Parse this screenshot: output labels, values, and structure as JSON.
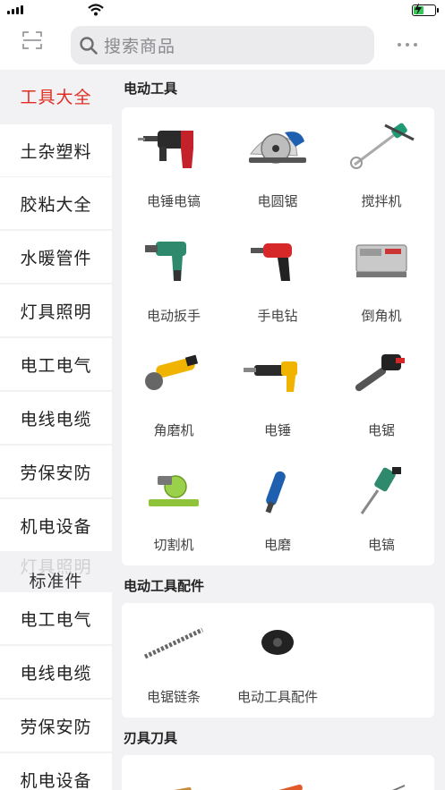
{
  "header": {
    "search_placeholder": "搜索商品"
  },
  "sidebar": {
    "items": [
      {
        "label": "工具大全",
        "active": true
      },
      {
        "label": "土杂塑料",
        "active": false
      },
      {
        "label": "胶粘大全",
        "active": false
      },
      {
        "label": "水暖管件",
        "active": false
      },
      {
        "label": "灯具照明",
        "active": false
      },
      {
        "label": "电工电气",
        "active": false
      },
      {
        "label": "电线电缆",
        "active": false
      },
      {
        "label": "劳保安防",
        "active": false
      },
      {
        "label": "机电设备",
        "active": false
      }
    ],
    "ghost_label": "灯具照明",
    "standard_label": "标准件",
    "items_after": [
      {
        "label": "电工电气"
      },
      {
        "label": "电线电缆"
      },
      {
        "label": "劳保安防"
      },
      {
        "label": "机电设备"
      }
    ]
  },
  "sections": [
    {
      "title": "电动工具",
      "products": [
        {
          "label": "电锤电镐",
          "icon": "rotary-hammer-icon"
        },
        {
          "label": "电圆锯",
          "icon": "circular-saw-icon"
        },
        {
          "label": "搅拌机",
          "icon": "mixer-icon"
        },
        {
          "label": "电动扳手",
          "icon": "impact-wrench-icon"
        },
        {
          "label": "手电钻",
          "icon": "hand-drill-icon"
        },
        {
          "label": "倒角机",
          "icon": "chamfering-machine-icon"
        },
        {
          "label": "角磨机",
          "icon": "angle-grinder-icon"
        },
        {
          "label": "电锤",
          "icon": "electric-hammer-icon"
        },
        {
          "label": "电锯",
          "icon": "chainsaw-icon"
        },
        {
          "label": "切割机",
          "icon": "cutting-machine-icon"
        },
        {
          "label": "电磨",
          "icon": "die-grinder-icon"
        },
        {
          "label": "电镐",
          "icon": "demolition-hammer-icon"
        }
      ]
    },
    {
      "title": "电动工具配件",
      "products": [
        {
          "label": "电锯链条",
          "icon": "saw-chain-icon"
        },
        {
          "label": "电动工具配件",
          "icon": "tool-accessory-icon"
        }
      ]
    },
    {
      "title": "刃具刀具",
      "products": [
        {
          "label": "",
          "icon": "chisels-icon"
        },
        {
          "label": "",
          "icon": "knives-icon"
        },
        {
          "label": "",
          "icon": "drill-bits-icon"
        }
      ]
    }
  ],
  "colors": {
    "accent": "#e02e24",
    "background": "#f2f2f4",
    "battery": "#35c759"
  }
}
